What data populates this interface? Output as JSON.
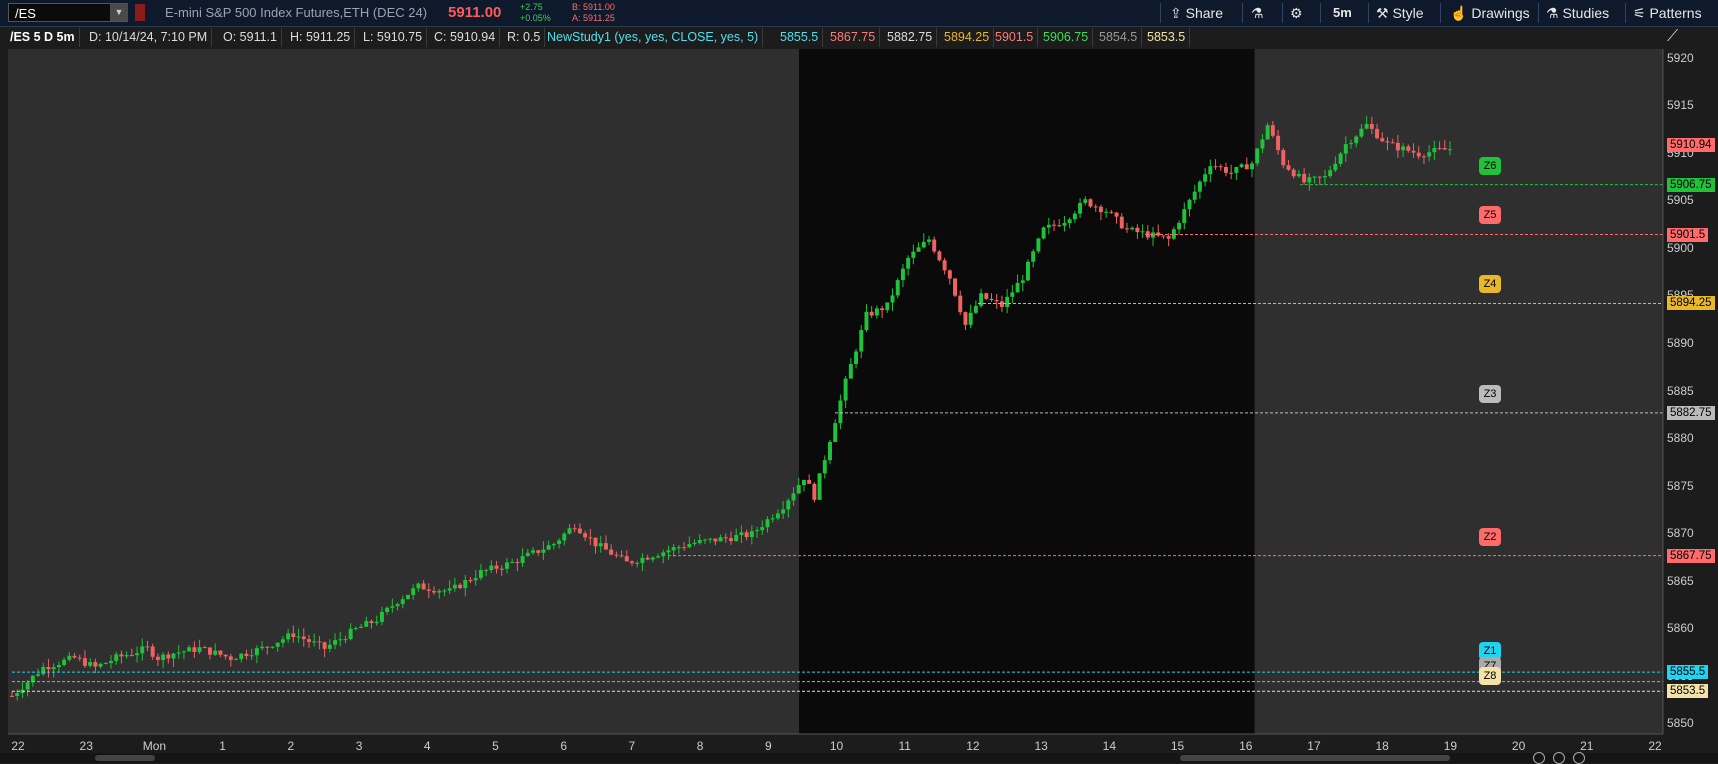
{
  "toolbar": {
    "symbol": "/ES",
    "description": "E-mini S&P 500 Index Futures,ETH (DEC 24)",
    "last": "5911.00",
    "net_change": "+2.75",
    "pct_change": "+0.05%",
    "bid": "B: 5911.00",
    "ask": "A: 5911.25",
    "share": "Share",
    "timeframe": "5m",
    "style": "Style",
    "drawings": "Drawings",
    "studies": "Studies",
    "patterns": "Patterns"
  },
  "infobar": {
    "series": "/ES 5 D 5m",
    "date": "D: 10/14/24, 7:10 PM",
    "open": "O: 5911.1",
    "high": "H: 5911.25",
    "low": "L: 5910.75",
    "close": "C: 5910.94",
    "range": "R: 0.5",
    "study": "NewStudy1 (yes, yes, CLOSE, yes, 5)",
    "study_values": [
      "5855.5",
      "5867.75",
      "5882.75",
      "5894.25",
      "5901.5",
      "5906.75",
      "5854.5",
      "5853.5"
    ]
  },
  "chart_data": {
    "type": "candlestick",
    "ylim": [
      5849,
      5921
    ],
    "y_ticks": [
      "5920",
      "5915",
      "5910",
      "5905",
      "5900",
      "5895",
      "5890",
      "5885",
      "5880",
      "5875",
      "5870",
      "5865",
      "5860",
      "5855",
      "5850"
    ],
    "x_ticks": [
      "22",
      "23",
      "Mon",
      "1",
      "2",
      "3",
      "4",
      "5",
      "6",
      "7",
      "8",
      "9",
      "10",
      "11",
      "12",
      "13",
      "14",
      "15",
      "16",
      "17",
      "18",
      "19",
      "20",
      "21",
      "22"
    ],
    "session_highlight": {
      "from_tick": "9",
      "to_tick": "16",
      "start_offset": 0.45,
      "end_offset": 0.13
    },
    "last_price_tag": {
      "value": "5910.94",
      "color": "#ff6b6b"
    },
    "zones": [
      {
        "label": "Z6",
        "value": 5906.75,
        "tag": "5906.75",
        "color": "#22c13a"
      },
      {
        "label": "Z5",
        "value": 5901.5,
        "tag": "5901.5",
        "color": "#ff6b6b"
      },
      {
        "label": "Z4",
        "value": 5894.25,
        "tag": "5894.25",
        "color": "#e8b82a"
      },
      {
        "label": "Z3",
        "value": 5882.75,
        "tag": "5882.75",
        "color": "#bbbbbb"
      },
      {
        "label": "Z2",
        "value": 5867.75,
        "tag": "5867.75",
        "color": "#ff6b6b"
      },
      {
        "label": "Z1",
        "value": 5855.5,
        "tag": "5855.5",
        "color": "#1ed4f0"
      },
      {
        "label": "Z7",
        "value": 5854.5,
        "tag": "",
        "color": "#aaaaaa"
      },
      {
        "label": "Z8",
        "value": 5853.5,
        "tag": "5853.5",
        "color": "#f4e3a8"
      }
    ],
    "anchors": [
      [
        0,
        5853
      ],
      [
        6,
        5856
      ],
      [
        12,
        5857
      ],
      [
        16,
        5856
      ],
      [
        20,
        5857
      ],
      [
        26,
        5858
      ],
      [
        28,
        5857
      ],
      [
        31,
        5857.5
      ],
      [
        36,
        5858
      ],
      [
        42,
        5857
      ],
      [
        48,
        5858
      ],
      [
        54,
        5859.5
      ],
      [
        60,
        5858
      ],
      [
        66,
        5860
      ],
      [
        70,
        5861
      ],
      [
        74,
        5863
      ],
      [
        78,
        5864.5
      ],
      [
        84,
        5864
      ],
      [
        90,
        5866
      ],
      [
        96,
        5867
      ],
      [
        100,
        5868
      ],
      [
        104,
        5869
      ],
      [
        108,
        5871
      ],
      [
        112,
        5869
      ],
      [
        118,
        5867
      ],
      [
        124,
        5868
      ],
      [
        130,
        5869
      ],
      [
        136,
        5869.5
      ],
      [
        142,
        5870
      ],
      [
        148,
        5873
      ],
      [
        152,
        5876
      ],
      [
        154,
        5874
      ],
      [
        157,
        5880
      ],
      [
        160,
        5886
      ],
      [
        164,
        5893
      ],
      [
        168,
        5894
      ],
      [
        172,
        5899
      ],
      [
        176,
        5901
      ],
      [
        180,
        5897
      ],
      [
        183,
        5892
      ],
      [
        186,
        5895
      ],
      [
        190,
        5894
      ],
      [
        194,
        5897
      ],
      [
        198,
        5902
      ],
      [
        202,
        5903
      ],
      [
        206,
        5905
      ],
      [
        210,
        5904
      ],
      [
        214,
        5902
      ],
      [
        218,
        5901.5
      ],
      [
        222,
        5901
      ],
      [
        226,
        5905
      ],
      [
        230,
        5909
      ],
      [
        234,
        5908
      ],
      [
        238,
        5909
      ],
      [
        241,
        5913
      ],
      [
        244,
        5909
      ],
      [
        248,
        5907
      ],
      [
        252,
        5907.5
      ],
      [
        256,
        5911
      ],
      [
        260,
        5913
      ],
      [
        264,
        5911
      ],
      [
        270,
        5910
      ],
      [
        276,
        5910.5
      ]
    ]
  }
}
